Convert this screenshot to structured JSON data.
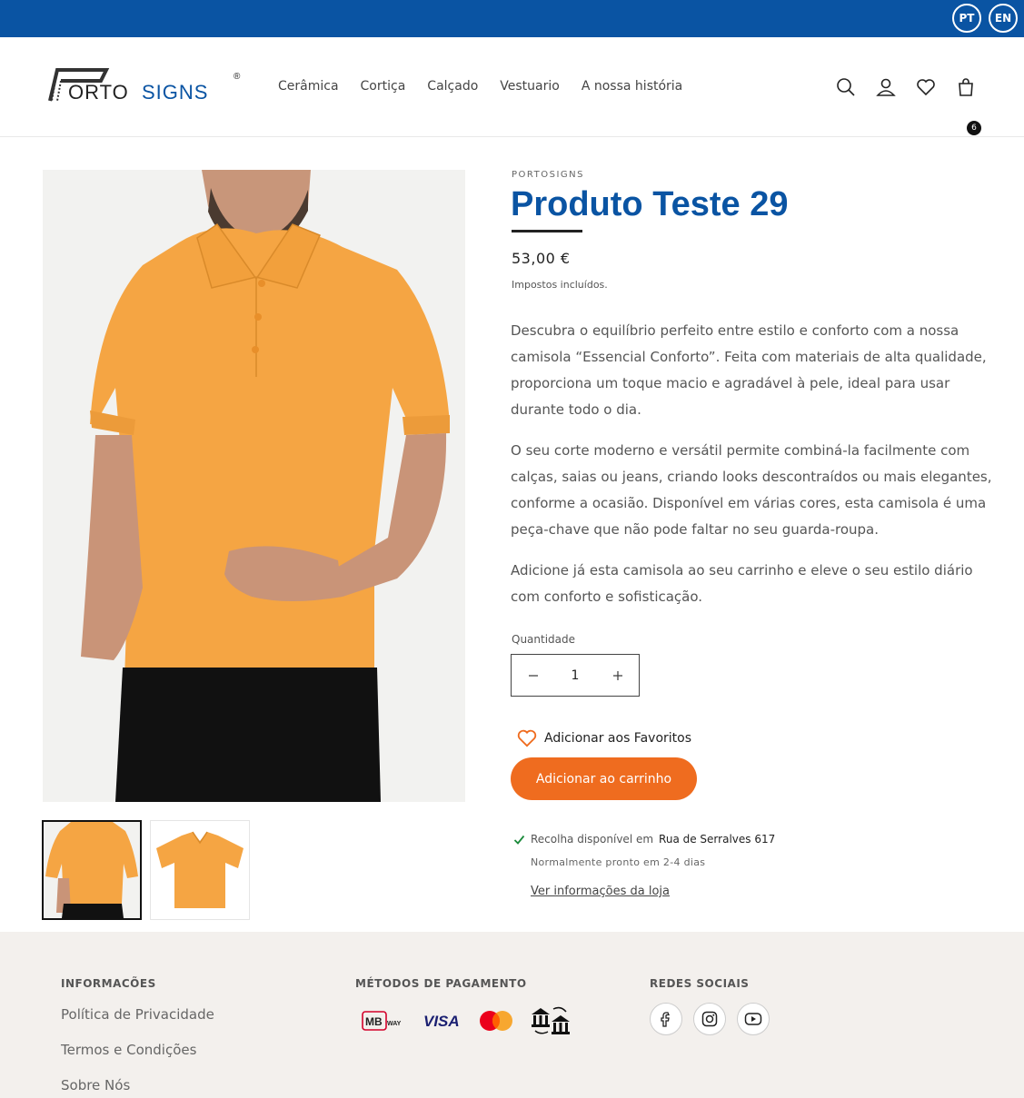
{
  "languages": [
    "PT",
    "EN"
  ],
  "brand": {
    "name_part1": "ORTO",
    "name_part2": "SIGNS",
    "registered": "®"
  },
  "nav": [
    "Cerâmica",
    "Cortiça",
    "Calçado",
    "Vestuario",
    "A nossa história"
  ],
  "header": {
    "cart_count": "6"
  },
  "product": {
    "vendor": "PORTOSIGNS",
    "title": "Produto Teste 29",
    "price": "53,00 €",
    "tax_note": "Impostos incluídos.",
    "description": [
      "Descubra o equilíbrio perfeito entre estilo e conforto com a nossa camisola “Essencial Conforto”. Feita com materiais de alta qualidade, proporciona um toque macio e agradável à pele, ideal para usar durante todo o dia.",
      "O seu corte moderno e versátil permite combiná-la facilmente com calças, saias ou jeans, criando looks descontraídos ou mais elegantes, conforme a ocasião. Disponível em várias cores, esta camisola é uma peça-chave que não pode faltar no seu guarda-roupa.",
      "Adicione já esta camisola ao seu carrinho e eleve o seu estilo diário com conforto e sofisticação."
    ],
    "quantity_label": "Quantidade",
    "quantity": "1",
    "favorite_label": "Adicionar aos Favoritos",
    "add_to_cart": "Adicionar ao carrinho",
    "pickup_prefix": "Recolha disponível em",
    "pickup_location": "Rua de Serralves 617",
    "pickup_ready": "Normalmente pronto em 2-4 dias",
    "store_info_link": "Ver informações da loja"
  },
  "colors": {
    "brand_blue": "#0a54a3",
    "accent_orange": "#ef6c1f",
    "shirt_orange": "#f5a543"
  },
  "footer": {
    "info_heading": "INFORMACÕES",
    "info_links": [
      "Política de Privacidade",
      "Termos e Condições",
      "Sobre Nós"
    ],
    "payment_heading": "MÉTODOS DE PAGAMENTO",
    "payment_methods": {
      "mbway": "MB",
      "mbway_small": "WAY",
      "visa": "VISA"
    },
    "social_heading": "REDES SOCIAIS",
    "social_icons": [
      "facebook-icon",
      "instagram-icon",
      "youtube-icon"
    ]
  }
}
